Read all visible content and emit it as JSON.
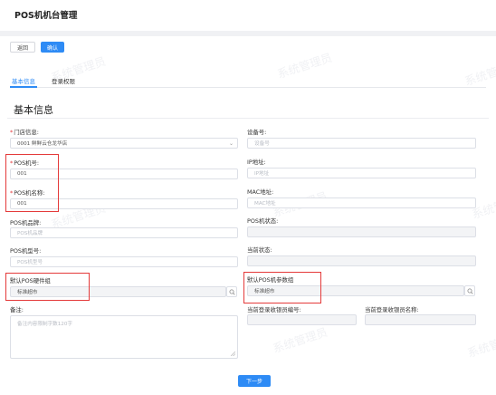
{
  "page": {
    "title": "POS机机台管理"
  },
  "toolbar": {
    "back_label": "返回",
    "confirm_label": "确认"
  },
  "tabs": [
    {
      "label": "基本信息",
      "active": true
    },
    {
      "label": "登录权限",
      "active": false
    }
  ],
  "section": {
    "title": "基本信息"
  },
  "form": {
    "store": {
      "label": "门店信息:",
      "value": "0001 鲜鲜云仓龙华店"
    },
    "device_no": {
      "label": "设备号:",
      "placeholder": "设备号"
    },
    "pos_no": {
      "label": "POS机号:",
      "value": "001"
    },
    "ip": {
      "label": "IP地址:",
      "placeholder": "IP地址"
    },
    "pos_name": {
      "label": "POS机名称:",
      "value": "001"
    },
    "mac": {
      "label": "MAC地址:",
      "placeholder": "MAC地址"
    },
    "brand": {
      "label": "POS机品牌:",
      "placeholder": "POS机品牌"
    },
    "status": {
      "label": "POS机状态:",
      "value": ""
    },
    "model": {
      "label": "POS机型号:",
      "placeholder": "POS机型号"
    },
    "current_status": {
      "label": "当前状态:",
      "value": ""
    },
    "hardware_group": {
      "label": "默认POS硬件组",
      "value": "标准超市"
    },
    "param_group": {
      "label": "默认POS机参数组",
      "value": "标准超市"
    },
    "remark": {
      "label": "备注:",
      "placeholder": "备注内容限制字数120字"
    },
    "cashier_no": {
      "label": "当前登录收银员编号:",
      "value": ""
    },
    "cashier_name": {
      "label": "当前登录收银员名称:",
      "value": ""
    }
  },
  "footer": {
    "next_label": "下一步"
  },
  "watermark": {
    "text": "系统管理员"
  },
  "colors": {
    "primary": "#2e8bf5",
    "highlight_box": "#e43a3a",
    "required": "#e4393c"
  }
}
